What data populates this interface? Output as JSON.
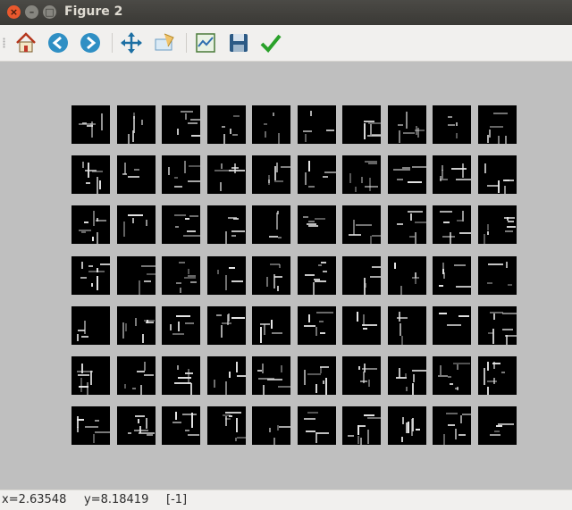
{
  "window": {
    "title": "Figure 2"
  },
  "toolbar": {
    "home": "home-icon",
    "back": "back-arrow-icon",
    "forward": "forward-arrow-icon",
    "pan": "pan-icon",
    "zoom": "zoom-rect-icon",
    "subplots": "subplots-icon",
    "save": "save-icon",
    "edit": "edit-check-icon"
  },
  "grid": {
    "rows": 7,
    "cols": 10
  },
  "status": {
    "x": "x=2.63548",
    "y": "y=8.18419",
    "value": "[-1]"
  },
  "colors": {
    "canvas": "#bfbfbf",
    "tile": "#000000",
    "stroke": "#e8e8e8"
  }
}
